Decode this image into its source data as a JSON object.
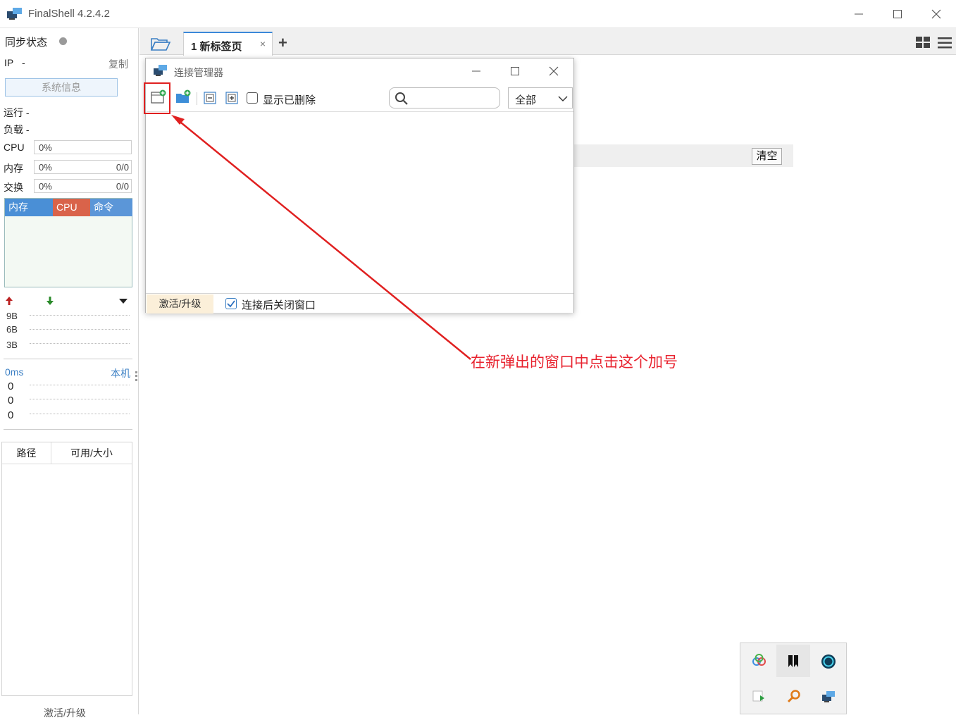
{
  "window": {
    "title": "FinalShell 4.2.4.2"
  },
  "left_panel": {
    "sync_label": "同步状态",
    "ip_label": "IP",
    "ip_value": "-",
    "copy_label": "复制",
    "sysinfo_button": "系统信息",
    "run_label": "运行 -",
    "load_label": "负载 -",
    "cpu": {
      "label": "CPU",
      "percent": "0%"
    },
    "memory": {
      "label": "内存",
      "percent": "0%",
      "ratio": "0/0"
    },
    "swap": {
      "label": "交换",
      "percent": "0%",
      "ratio": "0/0"
    },
    "proc_tabs": [
      "内存",
      "CPU",
      "命令"
    ],
    "net_scale": [
      "9B",
      "6B",
      "3B"
    ],
    "latency_label": "0ms",
    "latency_host": "本机",
    "latency_values": [
      "0",
      "0",
      "0"
    ],
    "disk_headers": [
      "路径",
      "可用/大小"
    ],
    "activate_label": "激活/升级"
  },
  "tabs": [
    {
      "label": "1 新标签页",
      "close": "×"
    }
  ],
  "add_tab": "+",
  "dialog": {
    "title": "连接管理器",
    "show_deleted_label": "显示已删除",
    "show_deleted_checked": false,
    "filter_value": "全部",
    "activate_label": "激活/升级",
    "close_after_connect_label": "连接后关闭窗口",
    "close_after_connect_checked": true
  },
  "console": {
    "clear_label": "清空"
  },
  "annotation": {
    "text": "在新弹出的窗口中点击这个加号",
    "color": "#e8232f"
  },
  "colors": {
    "proc_mem": "#4a8fd6",
    "proc_cpu": "#d9634a",
    "proc_cmd": "#5b96d8",
    "accent": "#3b88d9"
  }
}
